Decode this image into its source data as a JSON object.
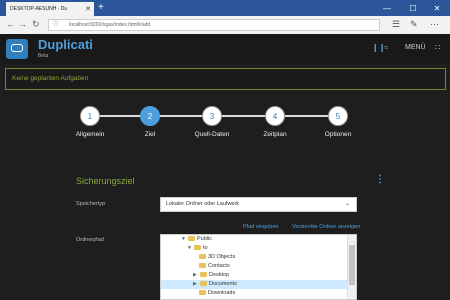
{
  "browser": {
    "tab_label": "DESKTOP-AESUNH · Du",
    "url": "localhost:8200/ngax/index.html#/add",
    "close_glyph": "✕",
    "new_tab_glyph": "+",
    "nav": {
      "back": "←",
      "forward": "→",
      "refresh": "↻"
    },
    "window_controls": {
      "minimize": "—",
      "maximize": "☐",
      "close": "✕"
    }
  },
  "app": {
    "title": "Duplicati",
    "subtitle": "Beta",
    "menu_label": "MENÜ",
    "pause_glyph": "❙❙",
    "throttle_glyph": "≈",
    "grid_glyph": "∷"
  },
  "banner": {
    "text": "Keine geplanten Aufgaben"
  },
  "steps": [
    {
      "number": "1",
      "label": "Allgemein"
    },
    {
      "number": "2",
      "label": "Ziel"
    },
    {
      "number": "3",
      "label": "Quell-Daten"
    },
    {
      "number": "4",
      "label": "Zeitplan"
    },
    {
      "number": "5",
      "label": "Optionen"
    }
  ],
  "active_step": 2,
  "destination": {
    "section_title": "Sicherungsziel",
    "storage_type_label": "Speichertyp",
    "storage_type_value": "Lokaler Ordner oder Laufwerk",
    "folder_label": "Ordnerpfad",
    "link_enter_path": "Pfad eingeben",
    "link_hidden_folders": "Versteckte Ordner anzeigen"
  },
  "tree": [
    {
      "label": "Public",
      "expanded": true
    },
    {
      "label": "to",
      "expanded": true
    },
    {
      "label": "3D Objects",
      "expanded": false
    },
    {
      "label": "Contacts",
      "expanded": false
    },
    {
      "label": "Desktop",
      "expanded": false
    },
    {
      "label": "Documents",
      "expanded": false
    },
    {
      "label": "Downloads",
      "expanded": false
    }
  ],
  "colors": {
    "accent": "#4ea0dc",
    "success_green": "#8aa83a",
    "background": "#1e1e1e"
  },
  "icons": [
    "page-icon",
    "back-icon",
    "forward-icon",
    "refresh-icon",
    "info-icon",
    "pause-icon",
    "throttle-icon",
    "grid-icon",
    "kebab-icon",
    "folder-icon",
    "chevron-down-icon"
  ]
}
